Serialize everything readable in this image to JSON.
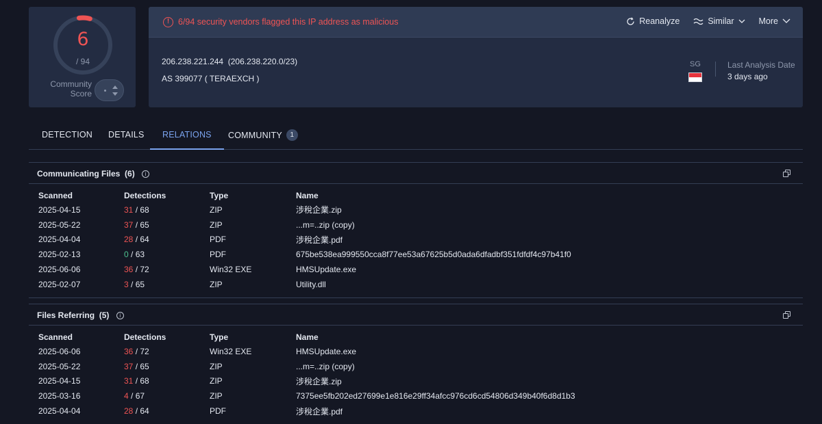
{
  "score": {
    "detections": "6",
    "total": "/ 94",
    "ratio": 0.0638,
    "community_label": "Community Score"
  },
  "alert": {
    "icon": "alert-circle-icon",
    "text": "6/94 security vendors flagged this IP address as malicious"
  },
  "actions": {
    "reanalyze": "Reanalyze",
    "similar": "Similar",
    "more": "More"
  },
  "ip": {
    "address": "206.238.221.244",
    "range": "(206.238.220.0/23)",
    "as_line": "AS 399077 ( TERAEXCH )"
  },
  "country": {
    "code": "SG",
    "flag": "singapore-flag"
  },
  "last_analysis": {
    "label": "Last Analysis Date",
    "value": "3 days ago"
  },
  "tabs": [
    {
      "label": "DETECTION",
      "active": false
    },
    {
      "label": "DETAILS",
      "active": false
    },
    {
      "label": "RELATIONS",
      "active": true
    },
    {
      "label": "COMMUNITY",
      "active": false,
      "badge": "1"
    }
  ],
  "columns": [
    "Scanned",
    "Detections",
    "Type",
    "Name"
  ],
  "communicating_files": {
    "title": "Communicating Files",
    "count": "(6)",
    "rows": [
      {
        "scanned": "2025-04-15",
        "det": "31",
        "total": "/ 68",
        "det_color": "red",
        "type": "ZIP",
        "name": "涉稅企業.zip"
      },
      {
        "scanned": "2025-05-22",
        "det": "37",
        "total": "/ 65",
        "det_color": "red",
        "type": "ZIP",
        "name": "...m=..zip (copy)"
      },
      {
        "scanned": "2025-04-04",
        "det": "28",
        "total": "/ 64",
        "det_color": "red",
        "type": "PDF",
        "name": "涉稅企業.pdf"
      },
      {
        "scanned": "2025-02-13",
        "det": "0",
        "total": "/ 63",
        "det_color": "green",
        "type": "PDF",
        "name": "675be538ea999550cca8f77ee53a67625b5d0ada6dfadbf351fdfdf4c97b41f0"
      },
      {
        "scanned": "2025-06-06",
        "det": "36",
        "total": "/ 72",
        "det_color": "red",
        "type": "Win32 EXE",
        "name": "HMSUpdate.exe"
      },
      {
        "scanned": "2025-02-07",
        "det": "3",
        "total": "/ 65",
        "det_color": "red",
        "type": "ZIP",
        "name": "Utility.dll"
      }
    ]
  },
  "files_referring": {
    "title": "Files Referring",
    "count": "(5)",
    "rows": [
      {
        "scanned": "2025-06-06",
        "det": "36",
        "total": "/ 72",
        "det_color": "red",
        "type": "Win32 EXE",
        "name": "HMSUpdate.exe"
      },
      {
        "scanned": "2025-05-22",
        "det": "37",
        "total": "/ 65",
        "det_color": "red",
        "type": "ZIP",
        "name": "...m=..zip (copy)"
      },
      {
        "scanned": "2025-04-15",
        "det": "31",
        "total": "/ 68",
        "det_color": "red",
        "type": "ZIP",
        "name": "涉稅企業.zip"
      },
      {
        "scanned": "2025-03-16",
        "det": "4",
        "total": "/ 67",
        "det_color": "red",
        "type": "ZIP",
        "name": "7375ee5fb202ed27699e1e816e29ff34afcc976cd6cd54806d349b40f6d8d1b3"
      },
      {
        "scanned": "2025-04-04",
        "det": "28",
        "total": "/ 64",
        "det_color": "red",
        "type": "PDF",
        "name": "涉稅企業.pdf"
      }
    ]
  },
  "colors": {
    "accent": "#7aa3ee",
    "malicious": "#ee5454",
    "clean": "#4dc28f",
    "background": "#141723",
    "card": "#232c42"
  }
}
